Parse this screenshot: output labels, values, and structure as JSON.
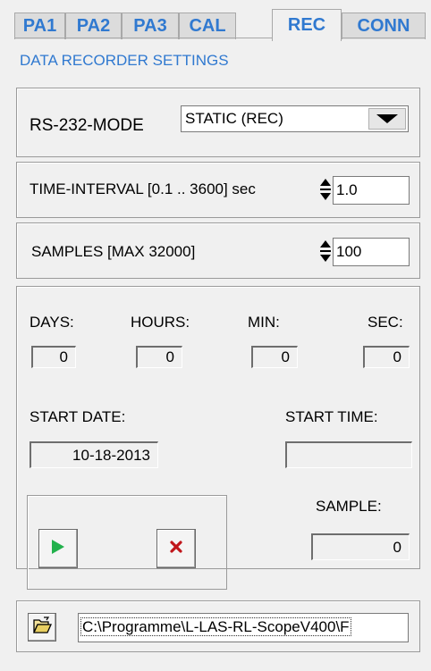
{
  "tabs": [
    {
      "label": "PA1"
    },
    {
      "label": "PA2"
    },
    {
      "label": "PA3"
    },
    {
      "label": "CAL"
    },
    {
      "label": "REC"
    },
    {
      "label": "CONN"
    }
  ],
  "active_tab": "REC",
  "subtitle": "DATA RECORDER SETTINGS",
  "rs232": {
    "label": "RS-232-MODE",
    "value": "STATIC (REC)"
  },
  "time_interval": {
    "label": "TIME-INTERVAL [0.1 .. 3600] sec",
    "value": "1.0"
  },
  "samples": {
    "label": "SAMPLES  [MAX 32000]",
    "value": "100"
  },
  "duration": {
    "days_label": "DAYS:",
    "days": "0",
    "hours_label": "HOURS:",
    "hours": "0",
    "min_label": "MIN:",
    "min": "0",
    "sec_label": "SEC:",
    "sec": "0"
  },
  "start": {
    "date_label": "START DATE:",
    "date": "10-18-2013",
    "time_label": "START TIME:",
    "time": ""
  },
  "sample": {
    "label": "SAMPLE:",
    "value": "0"
  },
  "path": {
    "value": "C:\\Programme\\L-LAS-RL-ScopeV400\\F"
  },
  "icons": {
    "start": "play-icon",
    "stop": "x-icon",
    "folder": "folder-open-icon"
  },
  "colors": {
    "accent": "#3079d0",
    "play": "#22b14c",
    "stop": "#c0161b"
  }
}
